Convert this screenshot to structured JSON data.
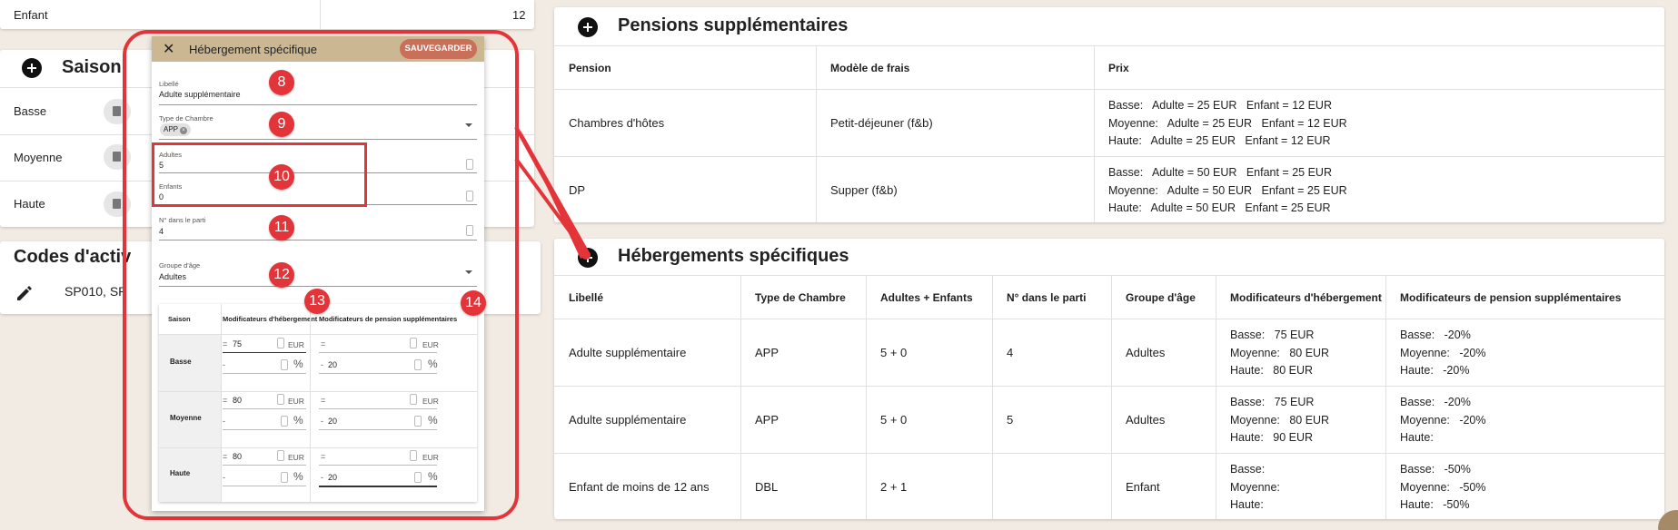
{
  "left": {
    "enfant_row": {
      "label": "Enfant",
      "value": "12"
    },
    "saison_card": {
      "title": "Saison",
      "rows": [
        "Basse",
        "Moyenne",
        "Haute"
      ]
    },
    "codes_card": {
      "title": "Codes d'activ",
      "codes": "SP010, SP"
    }
  },
  "pensions": {
    "title": "Pensions supplémentaires",
    "headers": [
      "Pension",
      "Modèle de frais",
      "Prix"
    ],
    "rows": [
      {
        "pension": "Chambres d'hôtes",
        "model": "Petit-déjeuner (f&b)",
        "prix": "Basse:   Adulte = 25 EUR   Enfant = 12 EUR\nMoyenne:   Adulte = 25 EUR   Enfant = 12 EUR\nHaute:   Adulte = 25 EUR   Enfant = 12 EUR"
      },
      {
        "pension": "DP",
        "model": "Supper (f&b)",
        "prix": "Basse:   Adulte = 50 EUR   Enfant = 25 EUR\nMoyenne:   Adulte = 50 EUR   Enfant = 25 EUR\nHaute:   Adulte = 50 EUR   Enfant = 25 EUR"
      }
    ]
  },
  "hebergements": {
    "title": "Hébergements spécifiques",
    "headers": [
      "Libellé",
      "Type de Chambre",
      "Adultes + Enfants",
      "N° dans le parti",
      "Groupe d'âge",
      "Modificateurs d'hébergement",
      "Modificateurs de pension supplémentaires"
    ],
    "rows": [
      {
        "libelle": "Adulte supplémentaire",
        "type": "APP",
        "ae": "5 + 0",
        "num": "4",
        "groupe": "Adultes",
        "mod_heb": "Basse:   75 EUR\nMoyenne:   80 EUR\nHaute:   80 EUR",
        "mod_pens": "Basse:   -20%\nMoyenne:   -20%\nHaute:   -20%"
      },
      {
        "libelle": "Adulte supplémentaire",
        "type": "APP",
        "ae": "5 + 0",
        "num": "5",
        "groupe": "Adultes",
        "mod_heb": "Basse:   75 EUR\nMoyenne:   80 EUR\nHaute:   90 EUR",
        "mod_pens": "Basse:   -20%\nMoyenne:   -20%\nHaute:"
      },
      {
        "libelle": "Enfant de moins de 12 ans",
        "type": "DBL",
        "ae": "2 + 1",
        "num": "",
        "groupe": "Enfant",
        "mod_heb": "Basse:\nMoyenne:\nHaute:",
        "mod_pens": "Basse:   -50%\nMoyenne:   -50%\nHaute:   -50%"
      }
    ]
  },
  "modal": {
    "title": "Hébergement spécifique",
    "save_label": "SAUVEGARDER",
    "close_glyph": "✕",
    "libelle_label": "Libellé",
    "libelle_value": "Adulte supplémentaire",
    "type_label": "Type de Chambre",
    "type_chip": "APP",
    "adultes_label": "Adultes",
    "adultes_value": "5",
    "enfants_label": "Enfants",
    "enfants_value": "0",
    "num_label": "N° dans le parti",
    "num_value": "4",
    "groupe_label": "Groupe d'âge",
    "groupe_value": "Adultes",
    "season_table": {
      "headers": [
        "Saison",
        "Modificateurs d'hébergement",
        "Modificateurs de pension supplémentaires"
      ],
      "rows": [
        {
          "season": "Basse",
          "heb_eq": "=",
          "heb_val": "75",
          "heb_unit": "EUR",
          "heb_pct_sign": "-",
          "heb_pct_val": "",
          "pct": "%",
          "pen_eq": "=",
          "pen_val": "",
          "pen_unit": "EUR",
          "pen_pct_sign": "-",
          "pen_pct_val": "20"
        },
        {
          "season": "Moyenne",
          "heb_eq": "=",
          "heb_val": "80",
          "heb_unit": "EUR",
          "heb_pct_sign": "-",
          "heb_pct_val": "",
          "pct": "%",
          "pen_eq": "=",
          "pen_val": "",
          "pen_unit": "EUR",
          "pen_pct_sign": "-",
          "pen_pct_val": "20"
        },
        {
          "season": "Haute",
          "heb_eq": "=",
          "heb_val": "80",
          "heb_unit": "EUR",
          "heb_pct_sign": "-",
          "heb_pct_val": "",
          "pct": "%",
          "pen_eq": "=",
          "pen_val": "",
          "pen_unit": "EUR",
          "pen_pct_sign": "-",
          "pen_pct_val": "20"
        }
      ]
    }
  },
  "annotations": [
    "8",
    "9",
    "10",
    "11",
    "12",
    "13",
    "14"
  ],
  "colors": {
    "accent_red": "#e3343a",
    "modal_header": "#cbb893",
    "save_button": "#c9705a",
    "background": "#f2ebe3"
  }
}
